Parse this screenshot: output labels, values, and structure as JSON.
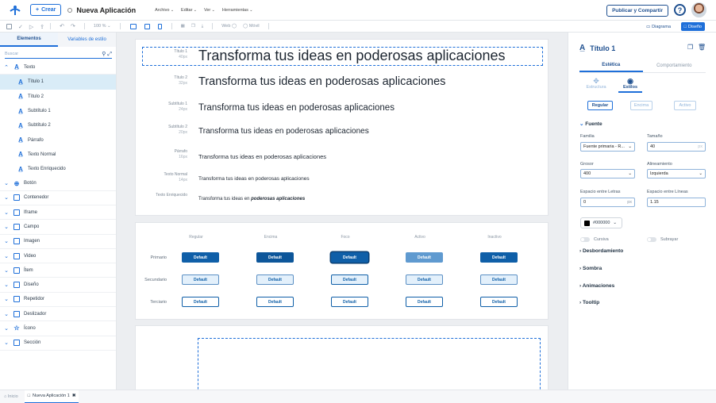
{
  "header": {
    "create_label": "Crear",
    "app_name": "Nueva Aplicación",
    "menu": [
      "Archivo",
      "Editar",
      "Ver",
      "Herramientas"
    ],
    "publish_label": "Publicar y Compartir",
    "help_label": "?"
  },
  "toolbar": {
    "zoom": "100 %",
    "web_label": "Web",
    "movil_label": "Móvil",
    "diagram_label": "Diagrama",
    "design_label": "Diseño"
  },
  "sidebar": {
    "tabs": [
      "Elementos",
      "Variables de estilo"
    ],
    "search_placeholder": "Buscar",
    "groups": [
      {
        "label": "Texto",
        "icon": "text-icon",
        "expanded": true,
        "children": [
          "Título 1",
          "Título 2",
          "Subtítulo 1",
          "Subtítulo 2",
          "Párrafo",
          "Texto Normal",
          "Texto Enriquecido"
        ]
      },
      {
        "label": "Botón",
        "icon": "button-icon"
      },
      {
        "label": "Contenedor",
        "icon": "container-icon"
      },
      {
        "label": "Iframe",
        "icon": "iframe-icon"
      },
      {
        "label": "Campo",
        "icon": "field-icon"
      },
      {
        "label": "Imagen",
        "icon": "image-icon"
      },
      {
        "label": "Video",
        "icon": "video-icon"
      },
      {
        "label": "Ítem",
        "icon": "item-icon"
      },
      {
        "label": "Diseño",
        "icon": "layout-icon"
      },
      {
        "label": "Repetidor",
        "icon": "repeater-icon"
      },
      {
        "label": "Deslizador",
        "icon": "slider-icon"
      },
      {
        "label": "Ícono",
        "icon": "star-icon"
      },
      {
        "label": "Sección",
        "icon": "section-icon"
      }
    ]
  },
  "typography": [
    {
      "name": "Título 1",
      "size": "40px",
      "sample": "Transforma tus ideas en poderosas aplicaciones"
    },
    {
      "name": "Título 2",
      "size": "32px",
      "sample": "Transforma tus ideas en poderosas aplicaciones"
    },
    {
      "name": "Subtítulo 1",
      "size": "24px",
      "sample": "Transforma tus ideas en poderosas aplicaciones"
    },
    {
      "name": "Subtítulo 2",
      "size": "20px",
      "sample": "Transforma tus ideas en poderosas aplicaciones"
    },
    {
      "name": "Párrafo",
      "size": "16px",
      "sample": "Transforma tus ideas en poderosas aplicaciones"
    },
    {
      "name": "Texto Normal",
      "size": "14px",
      "sample": "Transforma tus ideas en poderosas aplicaciones"
    },
    {
      "name": "Texto Enriquecido",
      "size": "",
      "sample": "Transforma tus ideas en ",
      "sample_bold": "poderosas aplicaciones"
    }
  ],
  "buttons": {
    "states": [
      "Regular",
      "Encima",
      "Foco",
      "Activo",
      "Inactivo"
    ],
    "rows": [
      "Primario",
      "Secundario",
      "Terciario"
    ],
    "label": "Default"
  },
  "properties": {
    "title": "Título 1",
    "tabs": [
      "Estética",
      "Comportamiento"
    ],
    "subtabs": [
      "Estructura",
      "Estilos"
    ],
    "states": [
      "Regular",
      "Encima",
      "Activo"
    ],
    "font_section": "Fuente",
    "family_label": "Familia",
    "family_value": "Fuente primaria - R...",
    "size_label": "Tamaño",
    "size_value": "40",
    "size_unit": "px",
    "weight_label": "Grosor",
    "weight_value": "400",
    "align_label": "Alineamiento",
    "align_value": "Izquierda",
    "letter_label": "Espacio entre Letras",
    "letter_value": "0",
    "letter_unit": "px",
    "line_label": "Espacio entre Líneas",
    "line_value": "1.15",
    "color_value": "#000000",
    "italic_label": "Cursiva",
    "underline_label": "Subrayar",
    "sections": [
      "Desbordamiento",
      "Sombra",
      "Animaciones",
      "Tooltip"
    ]
  },
  "bottom": {
    "home_label": "Inicio",
    "tab_label": "Nueva Aplicación 1"
  },
  "colors": {
    "accent": "#1e6fd9",
    "primary_btn": "#0f5fa8",
    "dark_blue": "#1e4f8f"
  }
}
